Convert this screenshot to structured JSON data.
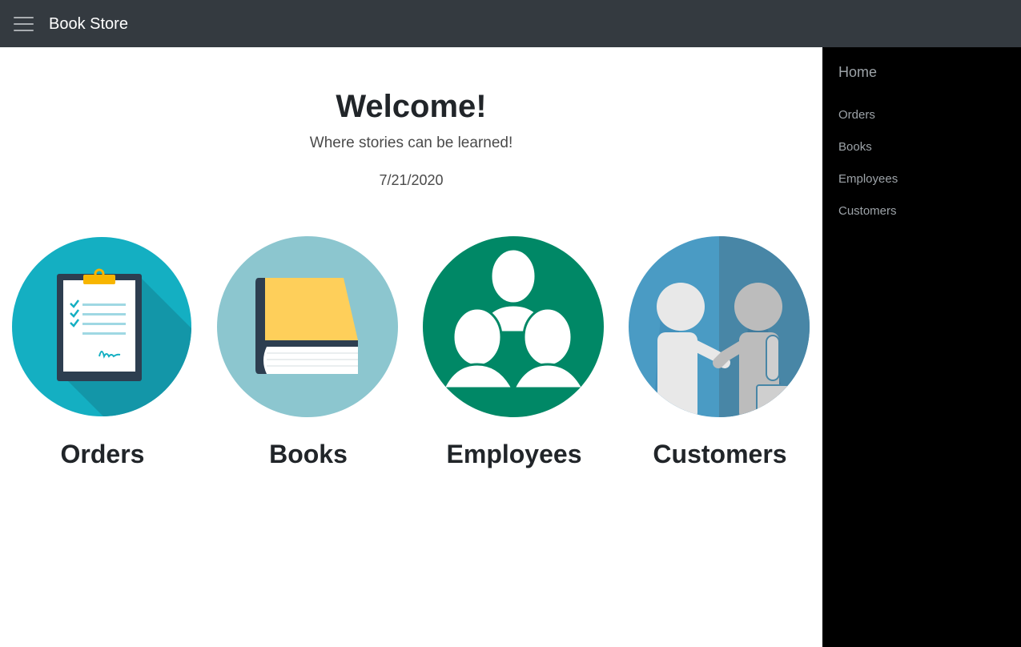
{
  "navbar": {
    "brand": "Book Store",
    "menu_icon": "hamburger-menu-icon",
    "background": "#343a40"
  },
  "main": {
    "title": "Welcome!",
    "subtitle": "Where stories can be learned!",
    "date": "7/21/2020",
    "tiles": [
      {
        "label": "Orders",
        "icon": "clipboard-icon",
        "color": "#14afc2"
      },
      {
        "label": "Books",
        "icon": "book-icon",
        "color": "#8cc6cf"
      },
      {
        "label": "Employees",
        "icon": "people-group-icon",
        "color": "#008866"
      },
      {
        "label": "Customers",
        "icon": "handshake-icon",
        "color": "#4a9bc4"
      }
    ]
  },
  "sidebar": {
    "home": "Home",
    "items": [
      {
        "label": "Orders"
      },
      {
        "label": "Books"
      },
      {
        "label": "Employees"
      },
      {
        "label": "Customers"
      }
    ],
    "background": "#000000"
  }
}
